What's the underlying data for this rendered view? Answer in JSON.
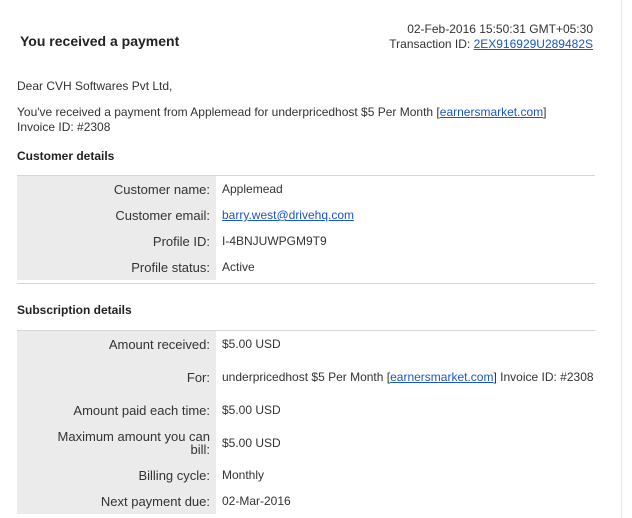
{
  "header": {
    "title": "You received a payment",
    "datetime": "02-Feb-2016 15:50:31 GMT+05:30",
    "transaction_label": "Transaction ID:",
    "transaction_id": "2EX916929U289482S"
  },
  "greeting": "Dear CVH Softwares Pvt Ltd,",
  "message": {
    "prefix": "You've received a payment from Applemead for underpricedhost $5 Per Month [",
    "link": "earnersmarket.com",
    "suffix": "]",
    "invoice": "Invoice ID: #2308"
  },
  "customer": {
    "section_title": "Customer details",
    "name_label": "Customer name:",
    "name_value": "Applemead",
    "email_label": "Customer email:",
    "email_value": "barry.west@drivehq.com",
    "profile_id_label": "Profile ID:",
    "profile_id_value": "I-4BNJUWPGM9T9",
    "profile_status_label": "Profile status:",
    "profile_status_value": "Active"
  },
  "subscription": {
    "section_title": "Subscription details",
    "amount_received_label": "Amount received:",
    "amount_received_value": "$5.00 USD",
    "for_label": "For:",
    "for_prefix": "underpricedhost $5 Per Month [",
    "for_link": "earnersmarket.com",
    "for_suffix": "] Invoice ID: #2308",
    "amount_each_label": "Amount paid each time:",
    "amount_each_value": "$5.00 USD",
    "max_amount_label": "Maximum amount you can bill:",
    "max_amount_value": "$5.00 USD",
    "billing_cycle_label": "Billing cycle:",
    "billing_cycle_value": "Monthly",
    "next_payment_label": "Next payment due:",
    "next_payment_value": "02-Mar-2016"
  }
}
